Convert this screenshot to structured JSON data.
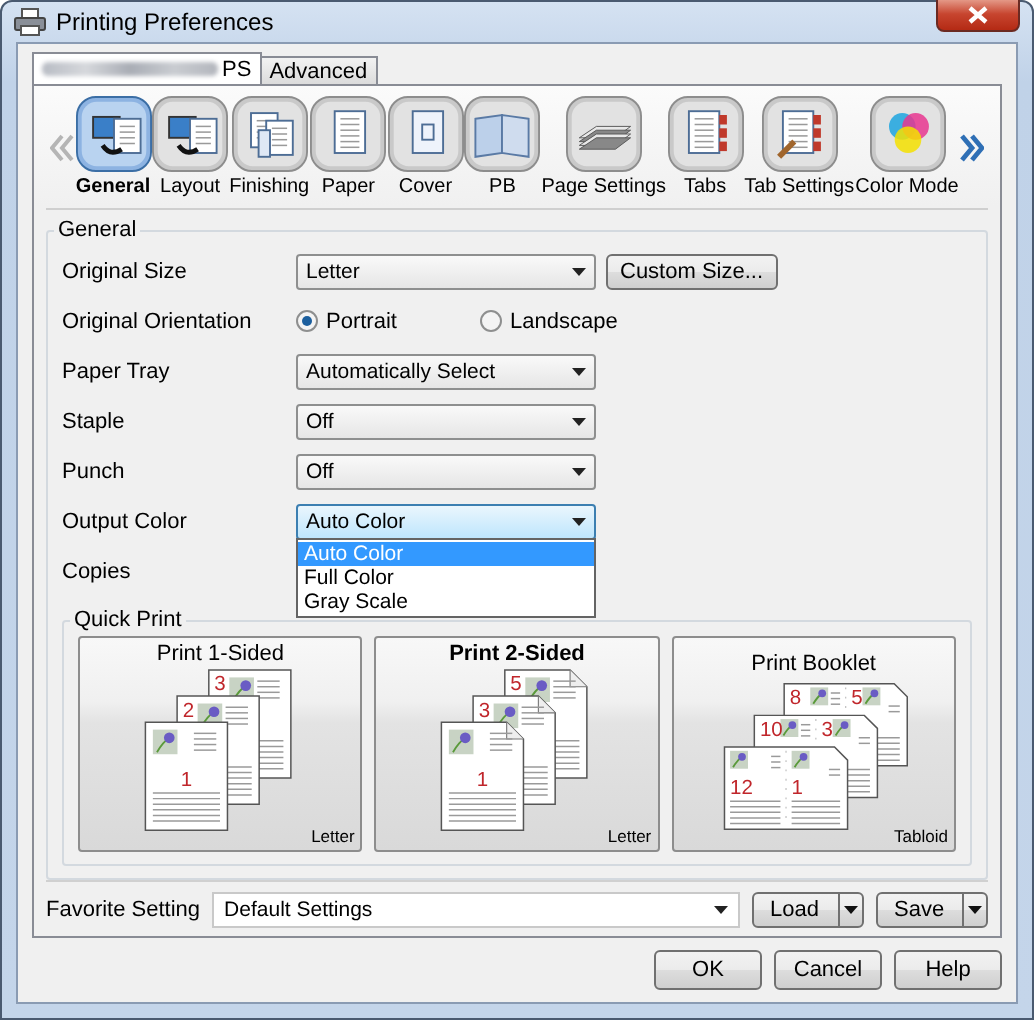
{
  "window": {
    "title": "Printing Preferences"
  },
  "tabs": [
    {
      "label": "PS",
      "kind": "masked",
      "selected": true
    },
    {
      "label": "Advanced",
      "kind": "plain",
      "selected": false
    }
  ],
  "categories": [
    {
      "label": "General",
      "selected": true
    },
    {
      "label": "Layout",
      "selected": false
    },
    {
      "label": "Finishing",
      "selected": false
    },
    {
      "label": "Paper",
      "selected": false
    },
    {
      "label": "Cover",
      "selected": false
    },
    {
      "label": "PB",
      "selected": false
    },
    {
      "label": "Page Settings",
      "selected": false
    },
    {
      "label": "Tabs",
      "selected": false
    },
    {
      "label": "Tab Settings",
      "selected": false
    },
    {
      "label": "Color Mode",
      "selected": false
    }
  ],
  "general": {
    "title": "General",
    "rows": [
      {
        "kind": "select",
        "label": "Original Size",
        "value": "Letter",
        "button": "Custom Size..."
      },
      {
        "kind": "radio",
        "label": "Original Orientation",
        "options": [
          {
            "label": "Portrait",
            "selected": true
          },
          {
            "label": "Landscape",
            "selected": false
          }
        ]
      },
      {
        "kind": "select",
        "label": "Paper Tray",
        "value": "Automatically Select"
      },
      {
        "kind": "select",
        "label": "Staple",
        "value": "Off"
      },
      {
        "kind": "select",
        "label": "Punch",
        "value": "Off"
      },
      {
        "kind": "select",
        "label": "Output Color",
        "value": "Auto Color",
        "open": true,
        "options": [
          {
            "label": "Auto Color",
            "selected": true
          },
          {
            "label": "Full Color",
            "selected": false
          },
          {
            "label": "Gray Scale",
            "selected": false
          }
        ]
      },
      {
        "kind": "label",
        "label": "Copies"
      }
    ]
  },
  "quick_print": {
    "title": "Quick Print",
    "cards": [
      {
        "title": "Print 1-Sided",
        "kind": "single",
        "selected": false,
        "paper": "Letter",
        "pages": [
          "3",
          "2",
          "1"
        ]
      },
      {
        "title": "Print 2-Sided",
        "kind": "duplex",
        "selected": true,
        "paper": "Letter",
        "pages": [
          "5",
          "3",
          "1"
        ]
      },
      {
        "title": "Print Booklet",
        "kind": "booklet",
        "selected": false,
        "paper": "Tabloid",
        "pages": [
          "8",
          "5",
          "10",
          "3",
          "12",
          "1"
        ]
      }
    ]
  },
  "favorite": {
    "label": "Favorite Setting",
    "value": "Default Settings",
    "buttons": [
      "Load",
      "Save"
    ]
  },
  "buttons": [
    "OK",
    "Cancel",
    "Help"
  ]
}
